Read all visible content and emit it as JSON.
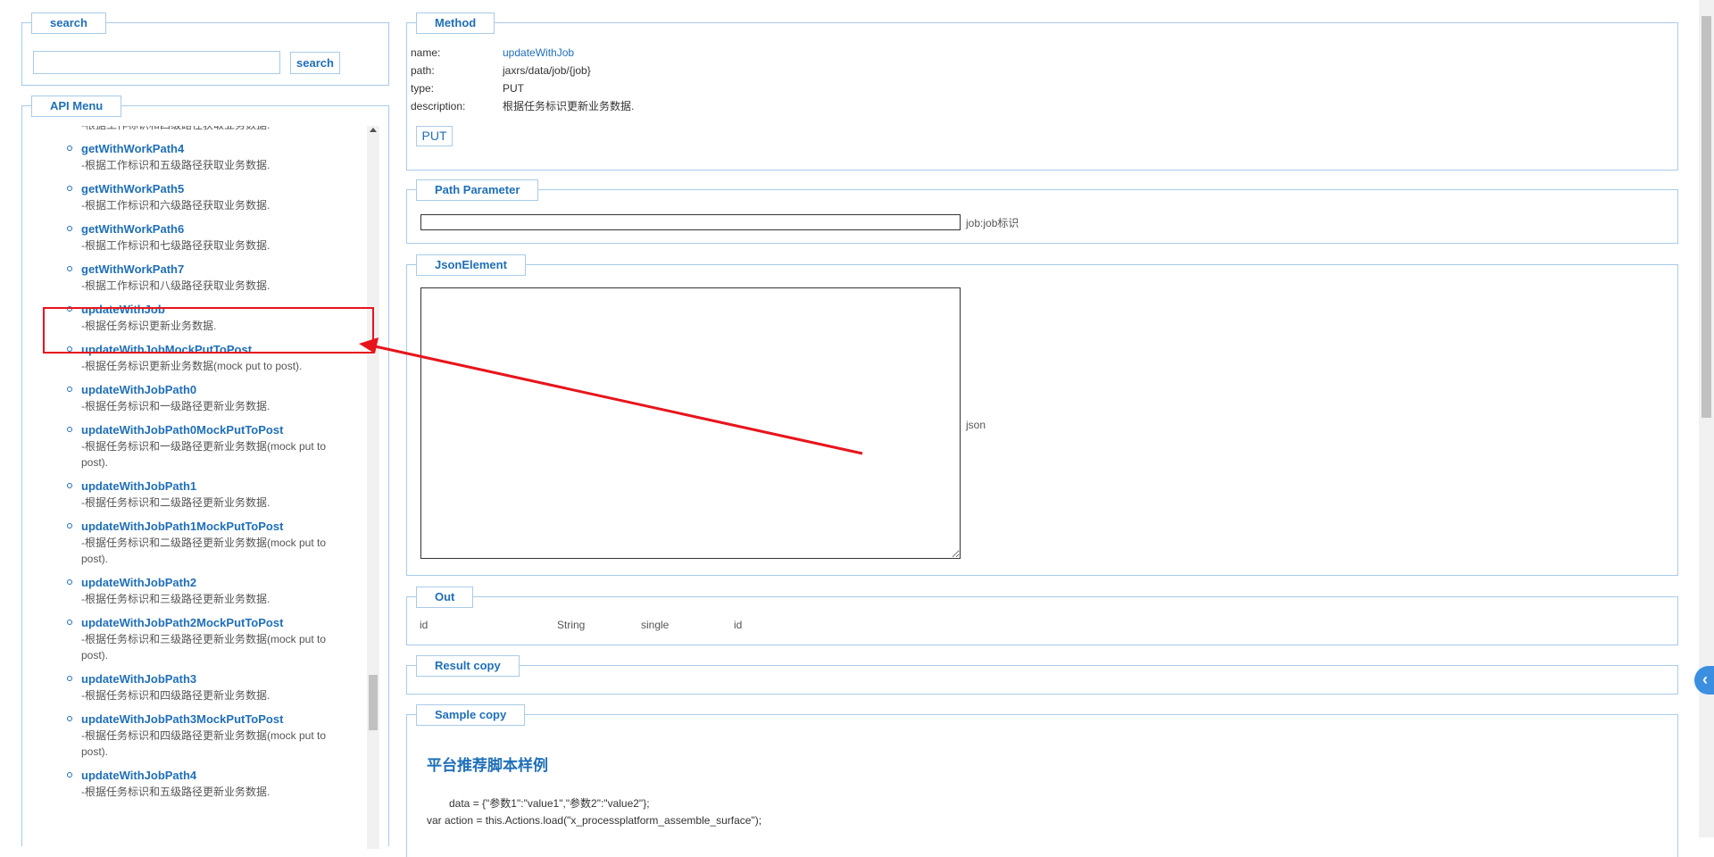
{
  "search": {
    "legend": "search",
    "input_value": "",
    "button_label": "search"
  },
  "api_menu": {
    "legend": "API Menu",
    "partial_desc": "-根据工作标识和四级路径获取业务数据.",
    "items": [
      {
        "name": "getWithWorkPath4",
        "desc": "-根据工作标识和五级路径获取业务数据."
      },
      {
        "name": "getWithWorkPath5",
        "desc": "-根据工作标识和六级路径获取业务数据."
      },
      {
        "name": "getWithWorkPath6",
        "desc": "-根据工作标识和七级路径获取业务数据."
      },
      {
        "name": "getWithWorkPath7",
        "desc": "-根据工作标识和八级路径获取业务数据."
      },
      {
        "name": "updateWithJob",
        "desc": "-根据任务标识更新业务数据."
      },
      {
        "name": "updateWithJobMockPutToPost",
        "desc": "-根据任务标识更新业务数据(mock put to post)."
      },
      {
        "name": "updateWithJobPath0",
        "desc": "-根据任务标识和一级路径更新业务数据."
      },
      {
        "name": "updateWithJobPath0MockPutToPost",
        "desc": "-根据任务标识和一级路径更新业务数据(mock put to post)."
      },
      {
        "name": "updateWithJobPath1",
        "desc": "-根据任务标识和二级路径更新业务数据."
      },
      {
        "name": "updateWithJobPath1MockPutToPost",
        "desc": "-根据任务标识和二级路径更新业务数据(mock put to post)."
      },
      {
        "name": "updateWithJobPath2",
        "desc": "-根据任务标识和三级路径更新业务数据."
      },
      {
        "name": "updateWithJobPath2MockPutToPost",
        "desc": "-根据任务标识和三级路径更新业务数据(mock put to post)."
      },
      {
        "name": "updateWithJobPath3",
        "desc": "-根据任务标识和四级路径更新业务数据."
      },
      {
        "name": "updateWithJobPath3MockPutToPost",
        "desc": "-根据任务标识和四级路径更新业务数据(mock put to post)."
      },
      {
        "name": "updateWithJobPath4",
        "desc": "-根据任务标识和五级路径更新业务数据."
      }
    ]
  },
  "method": {
    "legend": "Method",
    "name_label": "name:",
    "name_value": "updateWithJob",
    "path_label": "path:",
    "path_value": "jaxrs/data/job/{job}",
    "type_label": "type:",
    "type_value": "PUT",
    "description_label": "description:",
    "description_value": "根据任务标识更新业务数据.",
    "button_label": "PUT"
  },
  "path_parameter": {
    "legend": "Path Parameter",
    "job_value": "",
    "job_label": "job:job标识"
  },
  "json_element": {
    "legend": "JsonElement",
    "value": "",
    "label": "json"
  },
  "out": {
    "legend": "Out",
    "cells": [
      "id",
      "String",
      "single",
      "id"
    ]
  },
  "result": {
    "legend": "Result copy"
  },
  "sample": {
    "legend": "Sample copy",
    "heading": "平台推荐脚本样例",
    "line1": "data = {\"参数1\":\"value1\",\"参数2\":\"value2\"};",
    "line2": "var action = this.Actions.load(\"x_processplatform_assemble_surface\");"
  },
  "colors": {
    "accent": "#1f6fb8",
    "border": "#a9cbe8",
    "highlight": "#e8141b"
  }
}
